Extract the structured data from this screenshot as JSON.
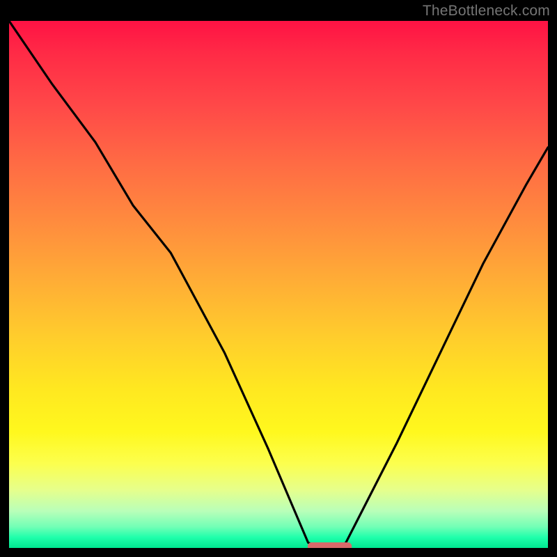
{
  "watermark": "TheBottleneck.com",
  "chart_data": {
    "type": "line",
    "title": "",
    "xlabel": "",
    "ylabel": "",
    "xlim": [
      0,
      100
    ],
    "ylim": [
      0,
      100
    ],
    "grid": false,
    "background_gradient": {
      "direction": "vertical",
      "stops": [
        {
          "pos": 0,
          "color": "#ff1244"
        },
        {
          "pos": 16,
          "color": "#ff4848"
        },
        {
          "pos": 38,
          "color": "#ff8b3e"
        },
        {
          "pos": 60,
          "color": "#ffcd2c"
        },
        {
          "pos": 78,
          "color": "#fff81e"
        },
        {
          "pos": 89,
          "color": "#e6ff8c"
        },
        {
          "pos": 96,
          "color": "#72ffb6"
        },
        {
          "pos": 100,
          "color": "#00e78f"
        }
      ]
    },
    "series": [
      {
        "name": "curve",
        "color": "#000000",
        "width": 3.2,
        "x": [
          0,
          8,
          16,
          23,
          30,
          40,
          48,
          53,
          55.5,
          58,
          61,
          62.5,
          64,
          72,
          80,
          88,
          96,
          100
        ],
        "y": [
          100,
          88,
          77,
          65,
          56,
          37,
          19,
          7,
          1,
          0,
          0,
          1,
          4,
          20,
          37,
          54,
          69,
          76
        ]
      }
    ],
    "markers": [
      {
        "name": "bottom-pill",
        "shape": "rounded-rect",
        "color": "#d86a6a",
        "x_center": 59.5,
        "y_center": 0.3,
        "width_pct": 8.2,
        "height_pct": 1.5,
        "radius_pct": 0.75
      }
    ]
  }
}
